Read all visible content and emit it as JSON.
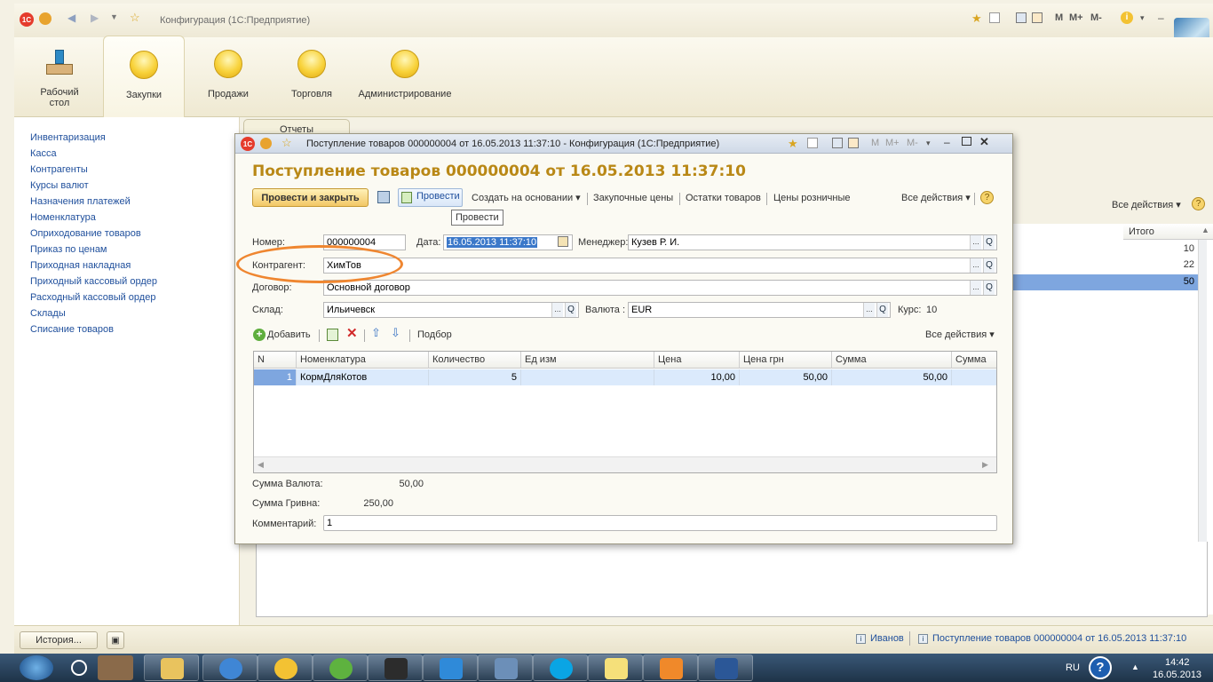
{
  "app": {
    "title": "Конфигурация  (1С:Предприятие)",
    "top_right_icons": [
      "star-icon",
      "bookmark-icon",
      "calculator-icon",
      "calendar-icon",
      "M",
      "M+",
      "M-",
      "info-icon",
      "minimize-icon",
      "close-icon"
    ],
    "m_labels": [
      "M",
      "M+",
      "M-"
    ]
  },
  "sections": [
    {
      "label": "Рабочий стол",
      "icon": "desk-icon"
    },
    {
      "label": "Закупки",
      "icon": "ball-icon"
    },
    {
      "label": "Продажи",
      "icon": "ball-icon"
    },
    {
      "label": "Торговля",
      "icon": "ball-icon"
    },
    {
      "label": "Администрирование",
      "icon": "ball-icon"
    }
  ],
  "nav": [
    "Инвентаризация",
    "Касса",
    "Контрагенты",
    "Курсы валют",
    "Назначения платежей",
    "Номенклатура",
    "Оприходование товаров",
    "Приказ по ценам",
    "Приходная накладная",
    "Приходный кассовый ордер",
    "Расходный кассовый ордер",
    "Склады",
    "Списание товаров"
  ],
  "background": {
    "reports_tab": "Отчеты",
    "all_actions": "Все действия",
    "column_total": "Итого",
    "totals": [
      "10",
      "22",
      "50"
    ]
  },
  "status": {
    "history": "История...",
    "user": "Иванов",
    "doc": "Поступление товаров 000000004 от 16.05.2013 11:37:10"
  },
  "modal": {
    "window_title": "Поступление товаров 000000004 от 16.05.2013 11:37:10 - Конфигурация  (1С:Предприятие)",
    "heading": "Поступление товаров 000000004 от 16.05.2013 11:37:10",
    "toolbar": {
      "post_close": "Провести и закрыть",
      "post": "Провести",
      "create_based": "Создать на основании",
      "purchase_prices": "Закупочные цены",
      "stock": "Остатки товаров",
      "retail_prices": "Цены розничные",
      "all_actions": "Все действия",
      "tooltip": "Провести"
    },
    "fields": {
      "number_label": "Номер:",
      "number": "000000004",
      "date_label": "Дата:",
      "date": "16.05.2013 11:37:10",
      "manager_label": "Менеджер:",
      "manager": "Кузев Р. И.",
      "counterparty_label": "Контрагент:",
      "counterparty": "ХимТов",
      "contract_label": "Договор:",
      "contract": "Основной договор",
      "warehouse_label": "Склад:",
      "warehouse": "Ильичевск",
      "currency_label": "Валюта :",
      "currency": "EUR",
      "rate_label": "Курс:",
      "rate": "10"
    },
    "table_toolbar": {
      "add": "Добавить",
      "pick": "Подбор",
      "all_actions": "Все действия"
    },
    "columns": [
      "N",
      "Номенклатура",
      "Количество",
      "Ед изм",
      "Цена",
      "Цена грн",
      "Сумма",
      "Сумма гр"
    ],
    "rows": [
      {
        "n": "1",
        "item": "КормДляКотов",
        "qty": "5",
        "unit": "",
        "price": "10,00",
        "price_uah": "50,00",
        "sum": "50,00",
        "sum_uah": ""
      }
    ],
    "totals": {
      "sum_currency_label": "Сумма Валюта:",
      "sum_currency": "50,00",
      "sum_uah_label": "Сумма Гривна:",
      "sum_uah": "250,00",
      "comment_label": "Комментарий:",
      "comment": "1"
    }
  },
  "taskbar": {
    "lang": "RU",
    "time": "14:42",
    "date": "16.05.2013"
  },
  "colors": {
    "accent": "#b98816",
    "link": "#1f4f9c",
    "highlight": "#ef8630",
    "selection": "#7ea6df"
  }
}
